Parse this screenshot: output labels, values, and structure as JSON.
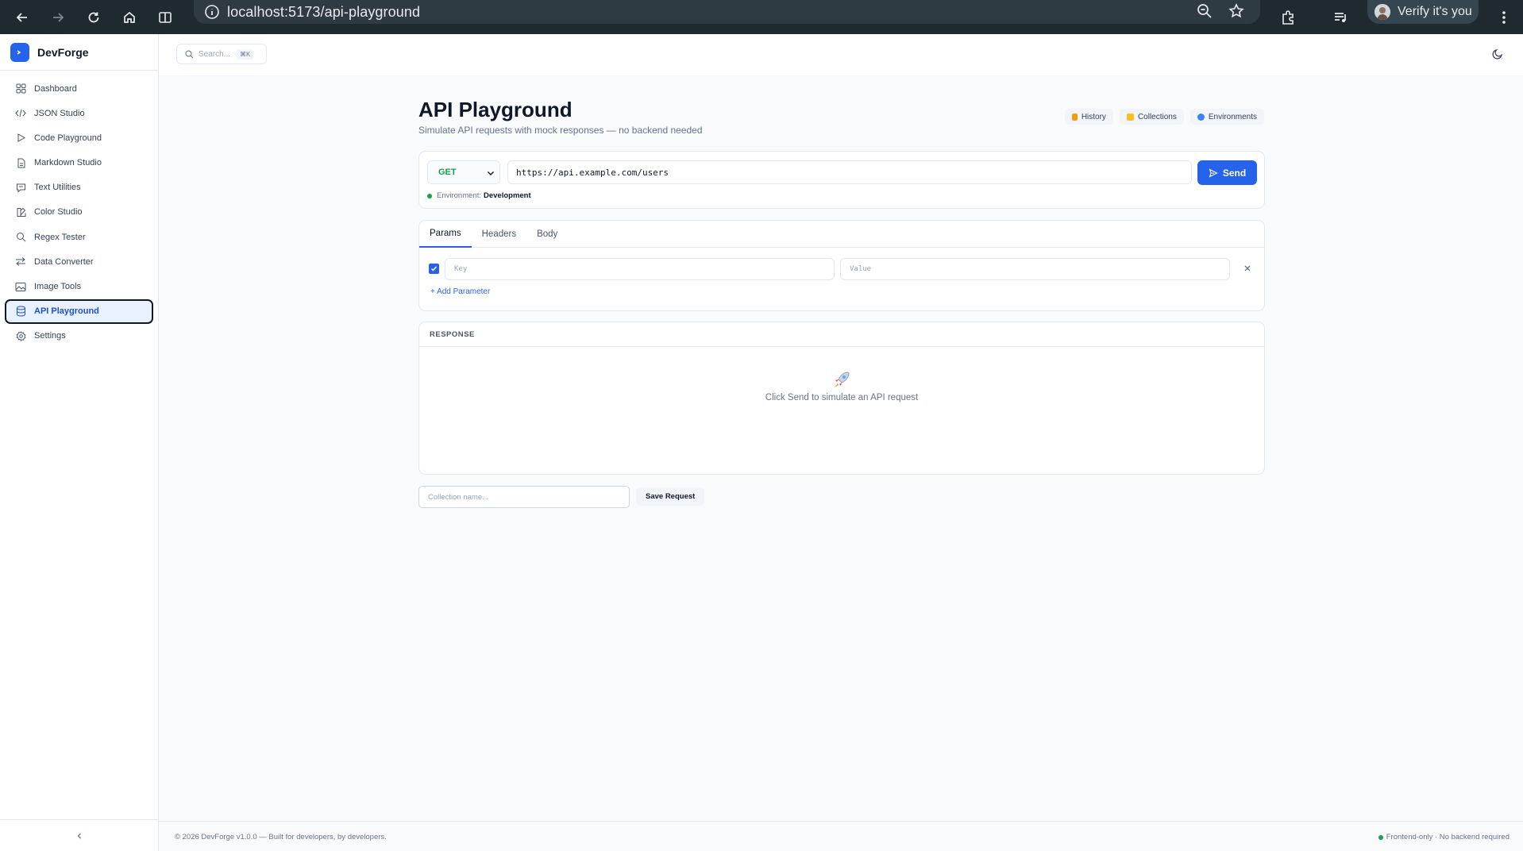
{
  "browser": {
    "url": "localhost:5173/api-playground",
    "profile_label": "Verify it's you"
  },
  "app": {
    "brand": "DevForge",
    "search_placeholder": "Search...",
    "search_shortcut": "⌘K"
  },
  "sidebar": {
    "items": [
      {
        "label": "Dashboard",
        "icon": "grid-icon"
      },
      {
        "label": "JSON Studio",
        "icon": "code-icon"
      },
      {
        "label": "Code Playground",
        "icon": "play-icon"
      },
      {
        "label": "Markdown Studio",
        "icon": "file-icon"
      },
      {
        "label": "Text Utilities",
        "icon": "message-icon"
      },
      {
        "label": "Color Studio",
        "icon": "palette-icon"
      },
      {
        "label": "Regex Tester",
        "icon": "search-icon"
      },
      {
        "label": "Data Converter",
        "icon": "arrows-icon"
      },
      {
        "label": "Image Tools",
        "icon": "image-icon"
      },
      {
        "label": "API Playground",
        "icon": "database-icon",
        "active": true
      },
      {
        "label": "Settings",
        "icon": "gear-icon"
      }
    ]
  },
  "page": {
    "title": "API Playground",
    "subtitle": "Simulate API requests with mock responses — no backend needed",
    "actions": {
      "history": "History",
      "collections": "Collections",
      "environments": "Environments"
    }
  },
  "request": {
    "method": "GET",
    "url": "https://api.example.com/users",
    "send_label": "Send",
    "environment_prefix": "Environment:",
    "environment_name": "Development"
  },
  "tabs": {
    "params": "Params",
    "headers": "Headers",
    "body": "Body",
    "active": "Params"
  },
  "params": {
    "key_placeholder": "Key",
    "value_placeholder": "Value",
    "add_label": "+ Add Parameter"
  },
  "response": {
    "header": "RESPONSE",
    "empty_message": "Click Send to simulate an API request"
  },
  "save": {
    "collection_placeholder": "Collection name...",
    "save_label": "Save Request"
  },
  "footer": {
    "left": "© 2026 DevForge v1.0.0 — Built for developers, by developers.",
    "right": "Frontend-only · No backend required"
  },
  "colors": {
    "accent": "#2563eb",
    "method_get": "#16a34a",
    "chrome": "#1f2a30"
  }
}
